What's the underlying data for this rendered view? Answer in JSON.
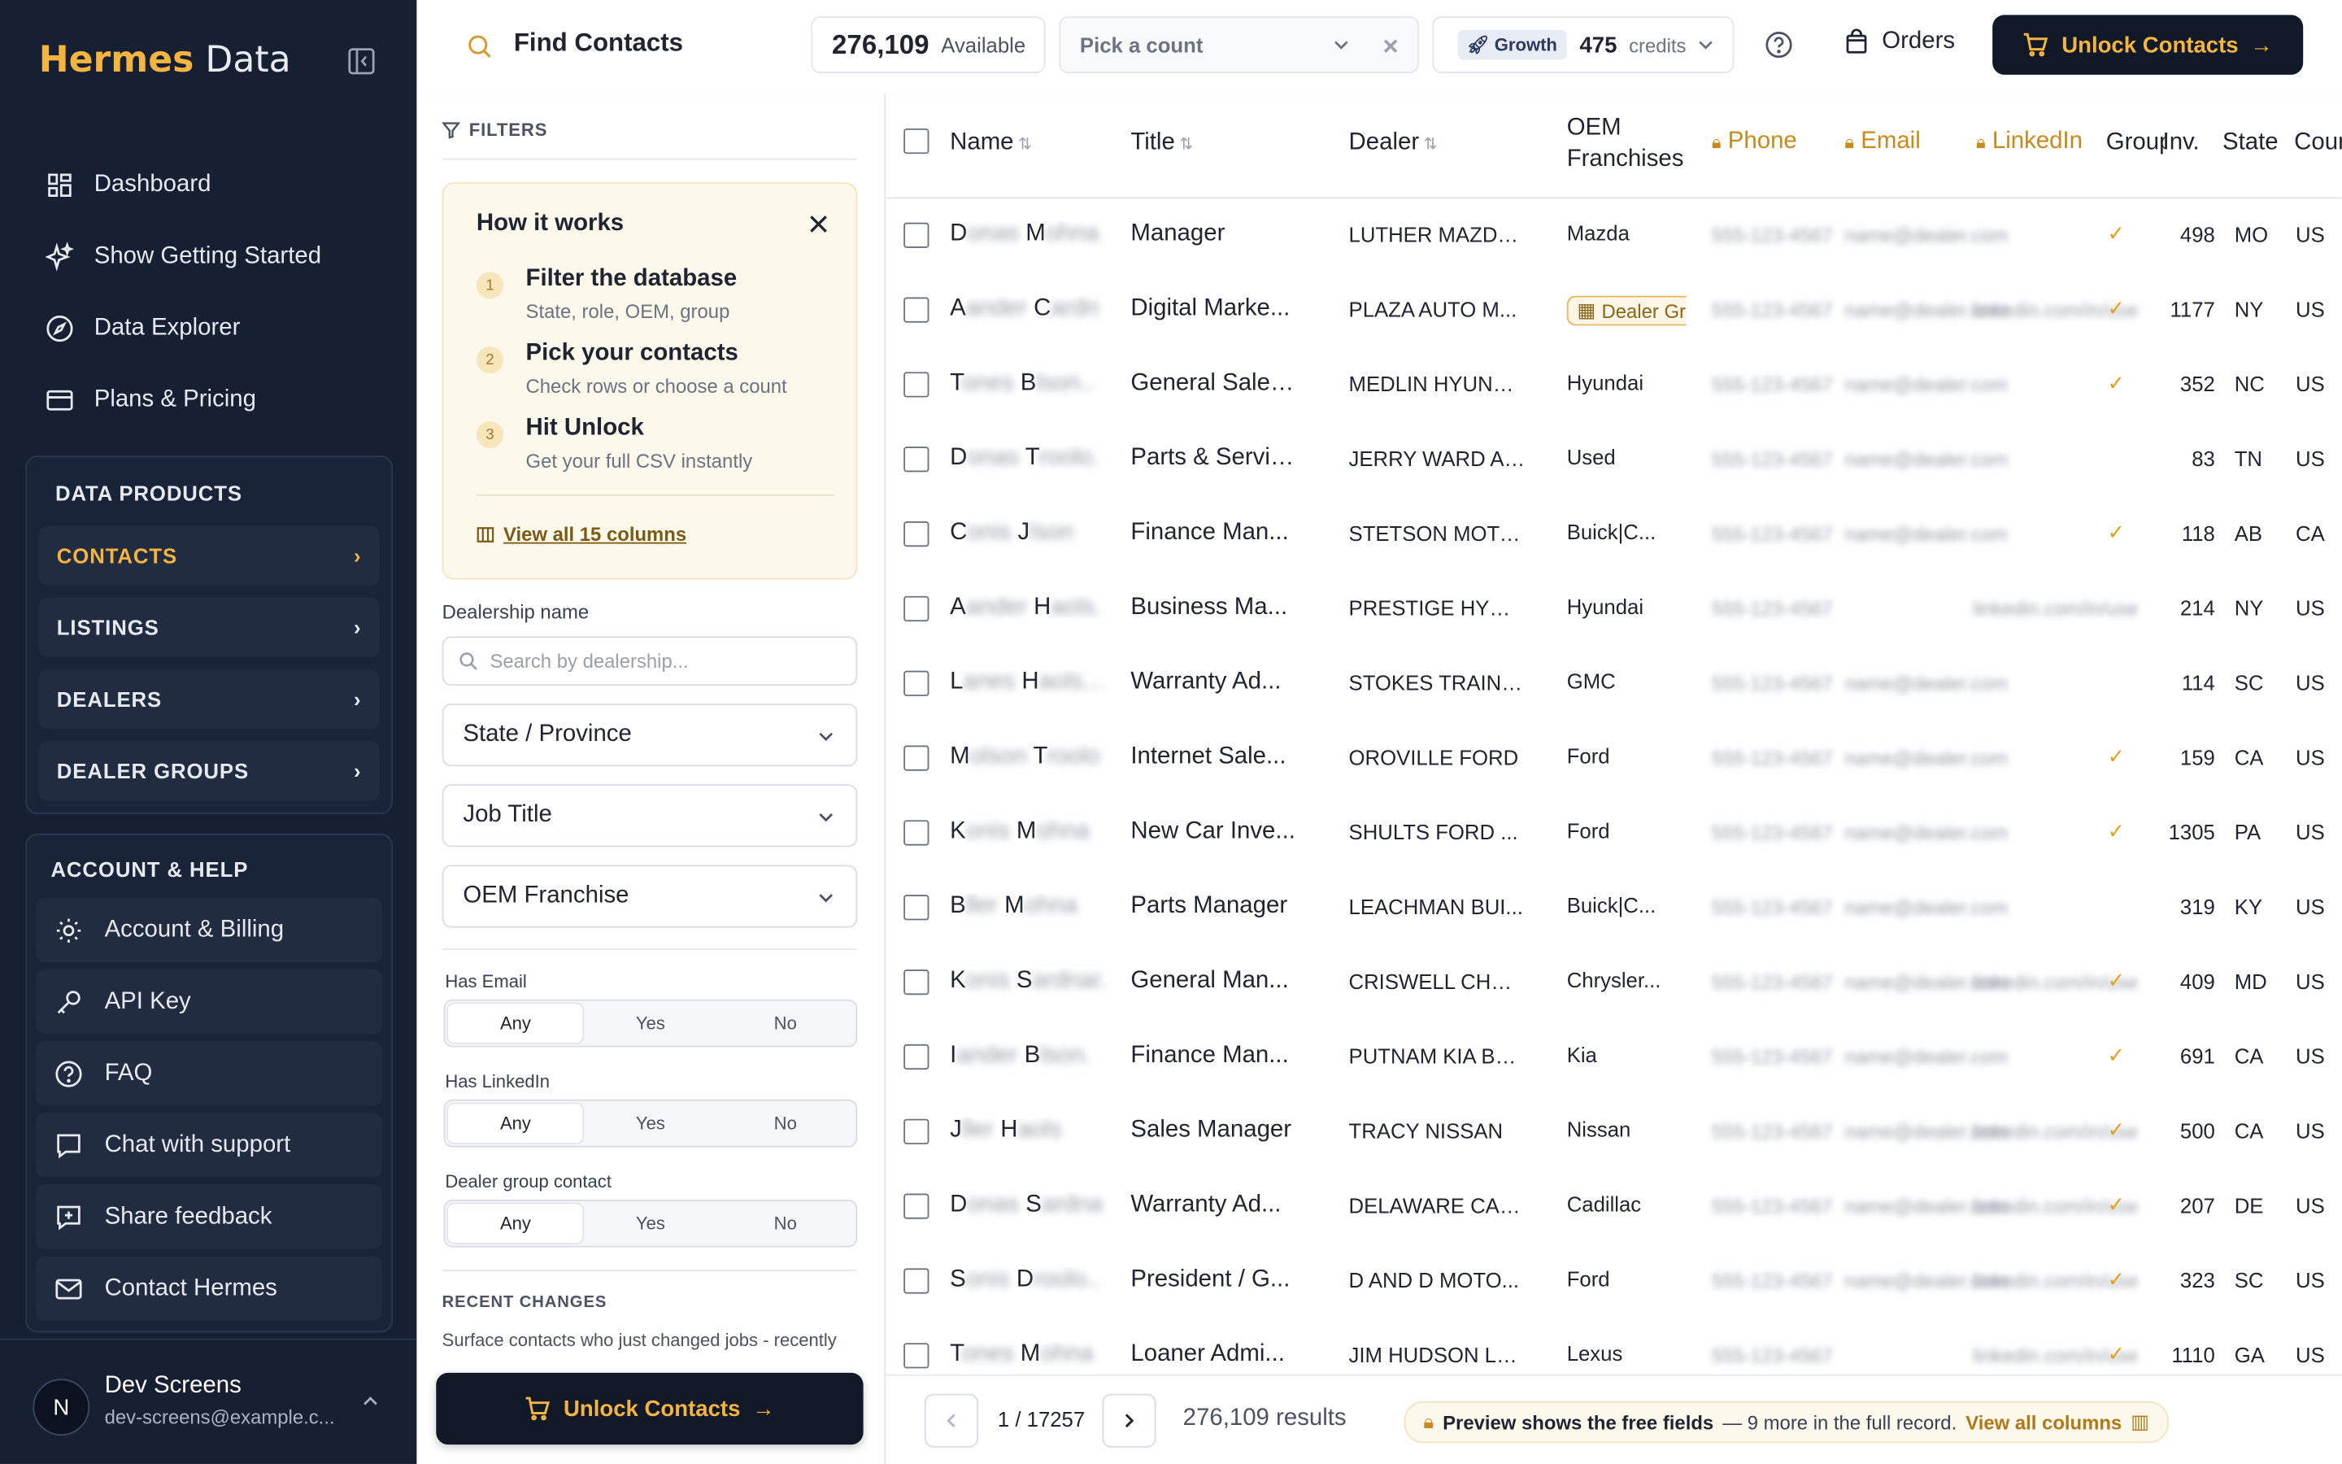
{
  "brand": {
    "part1": "Hermes",
    "part2": "Data"
  },
  "nav": [
    {
      "label": "Dashboard",
      "icon": "grid-icon"
    },
    {
      "label": "Show Getting Started",
      "icon": "sparkle-icon"
    },
    {
      "label": "Data Explorer",
      "icon": "compass-icon"
    },
    {
      "label": "Plans & Pricing",
      "icon": "card-icon"
    }
  ],
  "data_products": {
    "title": "DATA PRODUCTS",
    "items": [
      "CONTACTS",
      "LISTINGS",
      "DEALERS",
      "DEALER GROUPS"
    ]
  },
  "account_help": {
    "title": "ACCOUNT & HELP",
    "items": [
      "Account & Billing",
      "API Key",
      "FAQ",
      "Chat with support",
      "Share feedback",
      "Contact Hermes"
    ]
  },
  "user": {
    "initial": "N",
    "name": "Dev Screens",
    "email": "dev-screens@example.c..."
  },
  "topbar": {
    "title": "Find Contacts",
    "available_count": "276,109",
    "available_label": "Available",
    "pick_placeholder": "Pick a count",
    "plan": "Growth",
    "credits": "475",
    "credits_label": "credits",
    "orders": "Orders",
    "unlock": "Unlock Contacts"
  },
  "filters": {
    "header": "FILTERS",
    "how": {
      "title": "How it works",
      "steps": [
        {
          "num": "1",
          "title": "Filter the database",
          "desc": "State, role, OEM, group"
        },
        {
          "num": "2",
          "title": "Pick your contacts",
          "desc": "Check rows or choose a count"
        },
        {
          "num": "3",
          "title": "Hit Unlock",
          "desc": "Get your full CSV instantly"
        }
      ],
      "link": "View all 15 columns"
    },
    "dealership_label": "Dealership name",
    "dealership_placeholder": "Search by dealership...",
    "dropdowns": [
      "State / Province",
      "Job Title",
      "OEM Franchise"
    ],
    "toggles": [
      {
        "label": "Has Email",
        "options": [
          "Any",
          "Yes",
          "No"
        ],
        "selected": "Any"
      },
      {
        "label": "Has LinkedIn",
        "options": [
          "Any",
          "Yes",
          "No"
        ],
        "selected": "Any"
      },
      {
        "label": "Dealer group contact",
        "options": [
          "Any",
          "Yes",
          "No"
        ],
        "selected": "Any"
      }
    ],
    "recent_title": "RECENT CHANGES",
    "recent_desc": "Surface contacts who just changed jobs - recently",
    "unlock": "Unlock Contacts"
  },
  "table": {
    "columns": {
      "name": "Name",
      "title": "Title",
      "dealer": "Dealer",
      "oem": "OEM Franchises",
      "phone": "Phone",
      "email": "Email",
      "linkedin": "LinkedIn",
      "group": "Group",
      "inv": "Inv.",
      "state": "State",
      "country": "Country"
    },
    "rows": [
      {
        "first": "D",
        "first_rest": "onas",
        "last": "M",
        "last_rest": "ohna",
        "title": "Manager",
        "dealer": "LUTHER MAZDA...",
        "oem": "Mazda",
        "phone": "555-123-4567",
        "email": "name@dealer.com",
        "linkedin": "",
        "group": true,
        "inv": "498",
        "state": "MO",
        "country": "US"
      },
      {
        "first": "A",
        "first_rest": "ander",
        "last": "C",
        "last_rest": "ardn",
        "title": "Digital Marke...",
        "dealer": "PLAZA AUTO M...",
        "oem": "Dealer Group",
        "oem_badge": true,
        "phone": "555-123-4567",
        "email": "name@dealer.com",
        "linkedin": "linkedin.com/in/user",
        "group": true,
        "inv": "1177",
        "state": "NY",
        "country": "US"
      },
      {
        "first": "T",
        "first_rest": "ones",
        "last": "B",
        "last_rest": "lson..",
        "title": "General Sales...",
        "dealer": "MEDLIN HYUND...",
        "oem": "Hyundai",
        "phone": "555-123-4567",
        "email": "name@dealer.com",
        "linkedin": "",
        "group": true,
        "inv": "352",
        "state": "NC",
        "country": "US"
      },
      {
        "first": "D",
        "first_rest": "onas",
        "last": "T",
        "last_rest": "roolo.",
        "title": "Parts & Servic...",
        "dealer": "JERRY WARD AU...",
        "oem": "Used",
        "phone": "555-123-4567",
        "email": "name@dealer.com",
        "linkedin": "",
        "group": false,
        "inv": "83",
        "state": "TN",
        "country": "US"
      },
      {
        "first": "C",
        "first_rest": "onis",
        "last": "J",
        "last_rest": "lson",
        "title": "Finance Man...",
        "dealer": "STETSON MOTO...",
        "oem": "Buick|C...",
        "phone": "555-123-4567",
        "email": "name@dealer.com",
        "linkedin": "",
        "group": true,
        "inv": "118",
        "state": "AB",
        "country": "CA"
      },
      {
        "first": "A",
        "first_rest": "ander",
        "last": "H",
        "last_rest": "aols.",
        "title": "Business Ma...",
        "dealer": "PRESTIGE HYUN...",
        "oem": "Hyundai",
        "phone": "555-123-4567",
        "email": "",
        "linkedin": "linkedin.com/in/user",
        "group": false,
        "inv": "214",
        "state": "NY",
        "country": "US"
      },
      {
        "first": "L",
        "first_rest": "anes",
        "last": "H",
        "last_rest": "aols...",
        "title": "Warranty Ad...",
        "dealer": "STOKES TRAINO...",
        "oem": "GMC",
        "phone": "555-123-4567",
        "email": "name@dealer.com",
        "linkedin": "",
        "group": false,
        "inv": "114",
        "state": "SC",
        "country": "US"
      },
      {
        "first": "M",
        "first_rest": "olson",
        "last": "T",
        "last_rest": "roolo",
        "title": "Internet Sale...",
        "dealer": "OROVILLE FORD",
        "oem": "Ford",
        "phone": "555-123-4567",
        "email": "name@dealer.com",
        "linkedin": "",
        "group": true,
        "inv": "159",
        "state": "CA",
        "country": "US"
      },
      {
        "first": "K",
        "first_rest": "onis",
        "last": "M",
        "last_rest": "ohna",
        "title": "New Car Inve...",
        "dealer": "SHULTS FORD ...",
        "oem": "Ford",
        "phone": "555-123-4567",
        "email": "name@dealer.com",
        "linkedin": "",
        "group": true,
        "inv": "1305",
        "state": "PA",
        "country": "US"
      },
      {
        "first": "B",
        "first_rest": "ller",
        "last": "M",
        "last_rest": "ohna",
        "title": "Parts Manager",
        "dealer": "LEACHMAN BUI...",
        "oem": "Buick|C...",
        "phone": "555-123-4567",
        "email": "name@dealer.com",
        "linkedin": "",
        "group": false,
        "inv": "319",
        "state": "KY",
        "country": "US"
      },
      {
        "first": "K",
        "first_rest": "onis",
        "last": "S",
        "last_rest": "ardnar.",
        "title": "General Man...",
        "dealer": "CRISWELL CHRY...",
        "oem": "Chrysler...",
        "phone": "555-123-4567",
        "email": "name@dealer.com",
        "linkedin": "linkedin.com/in/user",
        "group": true,
        "inv": "409",
        "state": "MD",
        "country": "US"
      },
      {
        "first": "I",
        "first_rest": "ander",
        "last": "B",
        "last_rest": "lson.",
        "title": "Finance Man...",
        "dealer": "PUTNAM KIA BU...",
        "oem": "Kia",
        "phone": "555-123-4567",
        "email": "name@dealer.com",
        "linkedin": "",
        "group": true,
        "inv": "691",
        "state": "CA",
        "country": "US"
      },
      {
        "first": "J",
        "first_rest": "ller",
        "last": "H",
        "last_rest": "aols",
        "title": "Sales Manager",
        "dealer": "TRACY NISSAN",
        "oem": "Nissan",
        "phone": "555-123-4567",
        "email": "name@dealer.com",
        "linkedin": "linkedin.com/in/user",
        "group": true,
        "inv": "500",
        "state": "CA",
        "country": "US"
      },
      {
        "first": "D",
        "first_rest": "onas",
        "last": "S",
        "last_rest": "ardna",
        "title": "Warranty Ad...",
        "dealer": "DELAWARE CAD...",
        "oem": "Cadillac",
        "phone": "555-123-4567",
        "email": "name@dealer.com",
        "linkedin": "linkedin.com/in/user",
        "group": true,
        "inv": "207",
        "state": "DE",
        "country": "US"
      },
      {
        "first": "S",
        "first_rest": "onis",
        "last": "D",
        "last_rest": "roolo..",
        "title": "President / G...",
        "dealer": "D AND D MOTO...",
        "oem": "Ford",
        "phone": "555-123-4567",
        "email": "name@dealer.com",
        "linkedin": "linkedin.com/in/user",
        "group": true,
        "inv": "323",
        "state": "SC",
        "country": "US"
      },
      {
        "first": "T",
        "first_rest": "ones",
        "last": "M",
        "last_rest": "ohna",
        "title": "Loaner Admi...",
        "dealer": "JIM HUDSON LE...",
        "oem": "Lexus",
        "phone": "555-123-4567",
        "email": "",
        "linkedin": "linkedin.com/in/user",
        "group": true,
        "inv": "1110",
        "state": "GA",
        "country": "US"
      }
    ]
  },
  "footer": {
    "page": "1 / 17257",
    "results": "276,109 results",
    "preview_bold": "Preview shows the free fields",
    "preview_rest": "— 9 more in the full record.",
    "preview_link": "View all columns"
  },
  "colors": {
    "accent": "#f3b53f",
    "sidebar": "#172033",
    "dark_button": "#111827"
  }
}
